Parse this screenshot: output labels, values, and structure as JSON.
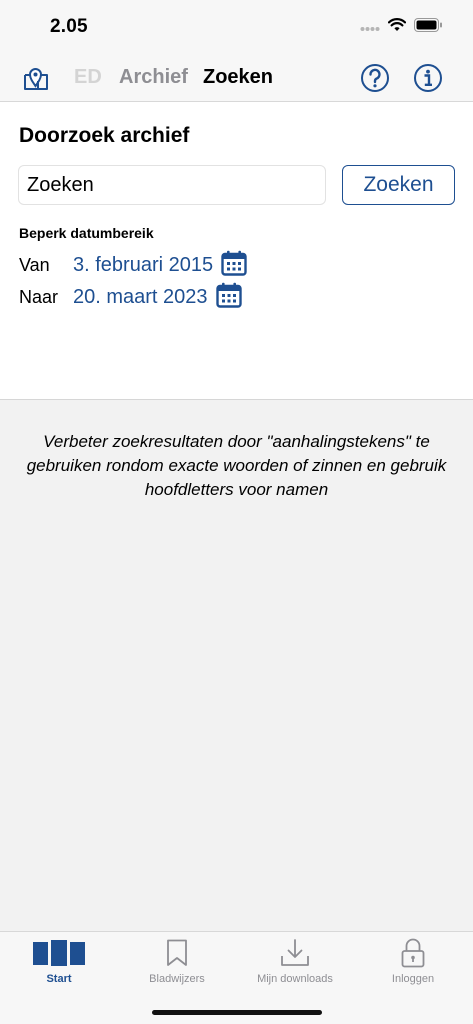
{
  "status_bar": {
    "time": "2.05"
  },
  "nav": {
    "tabs": [
      {
        "label": "ED",
        "state": "disabled"
      },
      {
        "label": "Archief",
        "state": "inactive"
      },
      {
        "label": "Zoeken",
        "state": "active"
      }
    ],
    "icons": [
      "map-pin-icon",
      "help-icon",
      "info-icon"
    ]
  },
  "search": {
    "title": "Doorzoek archief",
    "input_placeholder": "Zoeken",
    "button_label": "Zoeken",
    "date_heading": "Beperk datumbereik",
    "from_label": "Van",
    "from_value": "3. februari 2015",
    "to_label": "Naar",
    "to_value": "20. maart 2023"
  },
  "hint": "Verbeter zoekresultaten door \"aanhalingstekens\" te gebruiken rondom exacte woorden of zinnen en gebruik hoofdletters voor namen",
  "tab_bar": {
    "items": [
      {
        "label": "Start",
        "icon": "start-icon",
        "active": true
      },
      {
        "label": "Bladwijzers",
        "icon": "bookmark-icon",
        "active": false
      },
      {
        "label": "Mijn downloads",
        "icon": "download-icon",
        "active": false
      },
      {
        "label": "Inloggen",
        "icon": "lock-icon",
        "active": false
      }
    ]
  },
  "colors": {
    "accent": "#1e4f91",
    "inactive": "#8e8e93",
    "disabled": "#d4d4d4"
  }
}
